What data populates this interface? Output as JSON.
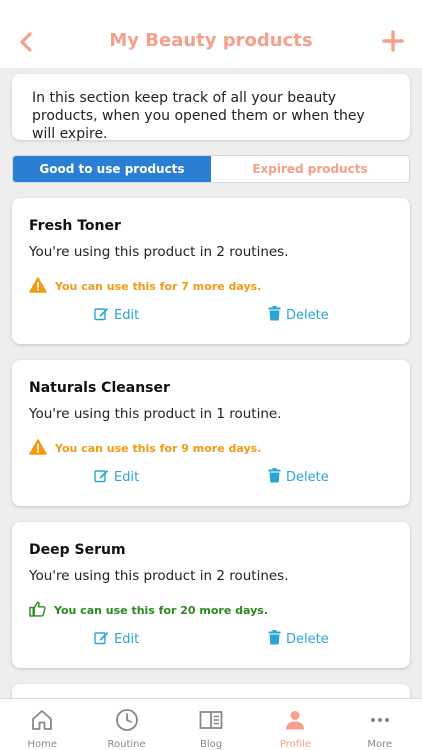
{
  "header": {
    "title": "My Beauty products",
    "back_icon": "chevron-left-icon",
    "add_icon": "plus-icon",
    "accent_color": "#f3a08c"
  },
  "info": {
    "text": "In this section keep track of all your beauty products, when you opened them or when they will expire."
  },
  "tabs": [
    {
      "label": "Good to use products",
      "active": true
    },
    {
      "label": "Expired products",
      "active": false
    }
  ],
  "products": [
    {
      "name": "Fresh Toner",
      "usage": "You're using this product in 2 routines.",
      "status": "You can use this for 7 more days.",
      "status_type": "warning",
      "edit_label": "Edit",
      "delete_label": "Delete"
    },
    {
      "name": "Naturals Cleanser",
      "usage": "You're using this product in 1 routine.",
      "status": "You can use this for 9 more days.",
      "status_type": "warning",
      "edit_label": "Edit",
      "delete_label": "Delete"
    },
    {
      "name": "Deep Serum",
      "usage": "You're using this product in 2 routines.",
      "status": "You can use this for 20 more days.",
      "status_type": "ok",
      "edit_label": "Edit",
      "delete_label": "Delete"
    }
  ],
  "tabbar": [
    {
      "label": "Home",
      "icon": "home-icon",
      "active": false
    },
    {
      "label": "Routine",
      "icon": "clock-icon",
      "active": false
    },
    {
      "label": "Blog",
      "icon": "book-icon",
      "active": false
    },
    {
      "label": "Profile",
      "icon": "person-icon",
      "active": true
    },
    {
      "label": "More",
      "icon": "more-icon",
      "active": false
    }
  ],
  "colors": {
    "primary_blue": "#2a7fd4",
    "link_blue": "#2aa5d6",
    "warning": "#f39a12",
    "ok": "#2a8a1f"
  }
}
